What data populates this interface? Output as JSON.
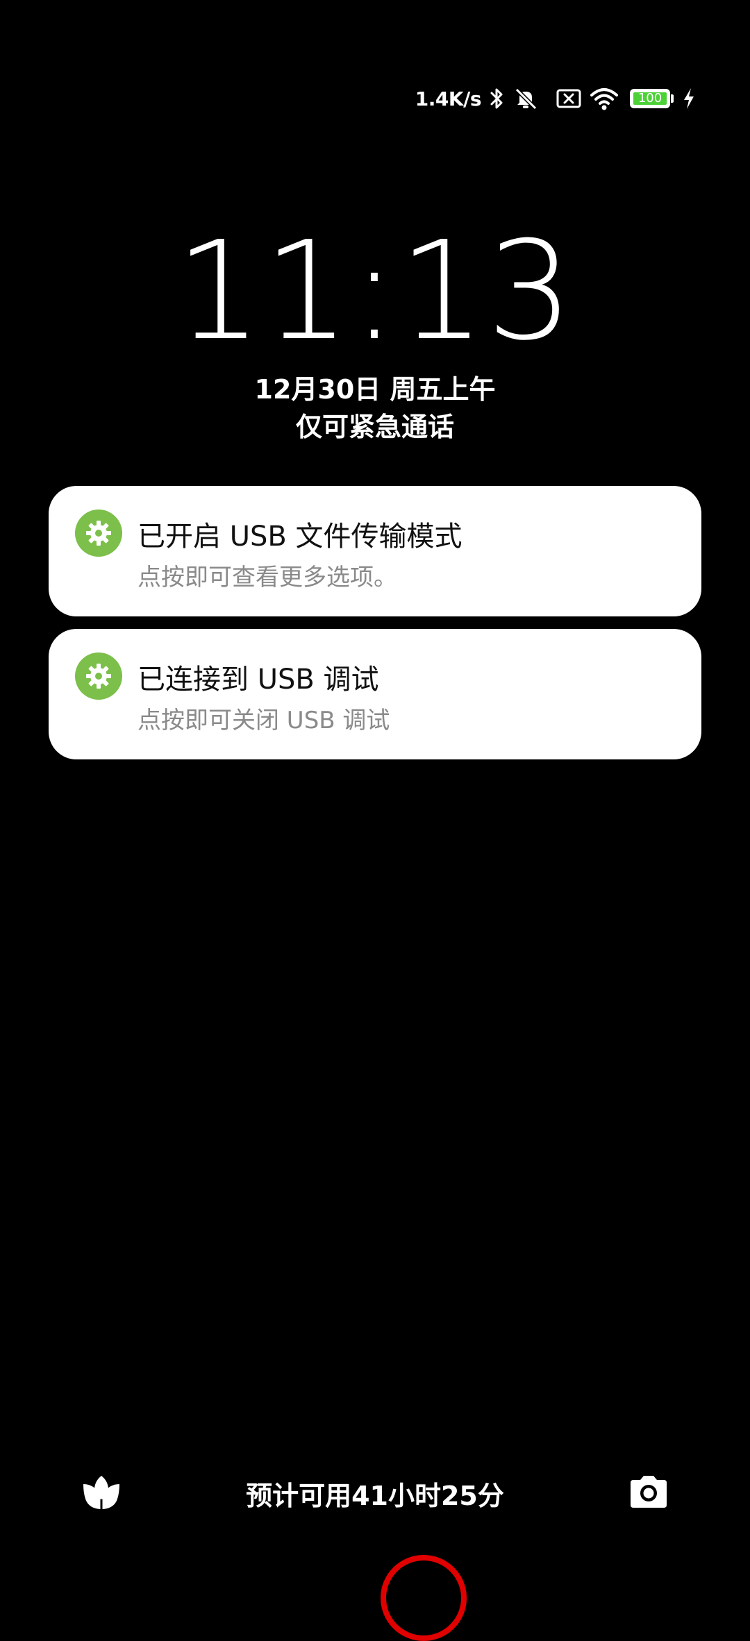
{
  "status_bar": {
    "net_speed": "1.4K/s",
    "battery_level": "100",
    "icons": [
      "bluetooth-icon",
      "alarm-off-icon",
      "sim-missing-icon",
      "wifi-icon",
      "battery-icon",
      "charging-icon"
    ]
  },
  "lockscreen": {
    "time": "11:13",
    "date": "12月30日 周五上午",
    "emergency_text": "仅可紧急通话"
  },
  "notifications": [
    {
      "icon": "settings-gear-icon",
      "title": "已开启 USB 文件传输模式",
      "subtitle": "点按即可查看更多选项。"
    },
    {
      "icon": "settings-gear-icon",
      "title": "已连接到 USB 调试",
      "subtitle": "点按即可关闭 USB 调试"
    }
  ],
  "bottom_bar": {
    "left_icon": "tulip-icon",
    "battery_estimate": "预计可用41小时25分",
    "right_icon": "camera-icon"
  },
  "colors": {
    "background": "#000000",
    "notification_bg": "#ffffff",
    "icon_green": "#7cbf4a",
    "battery_green": "#4cd137",
    "touch_indicator": "#e00000"
  }
}
